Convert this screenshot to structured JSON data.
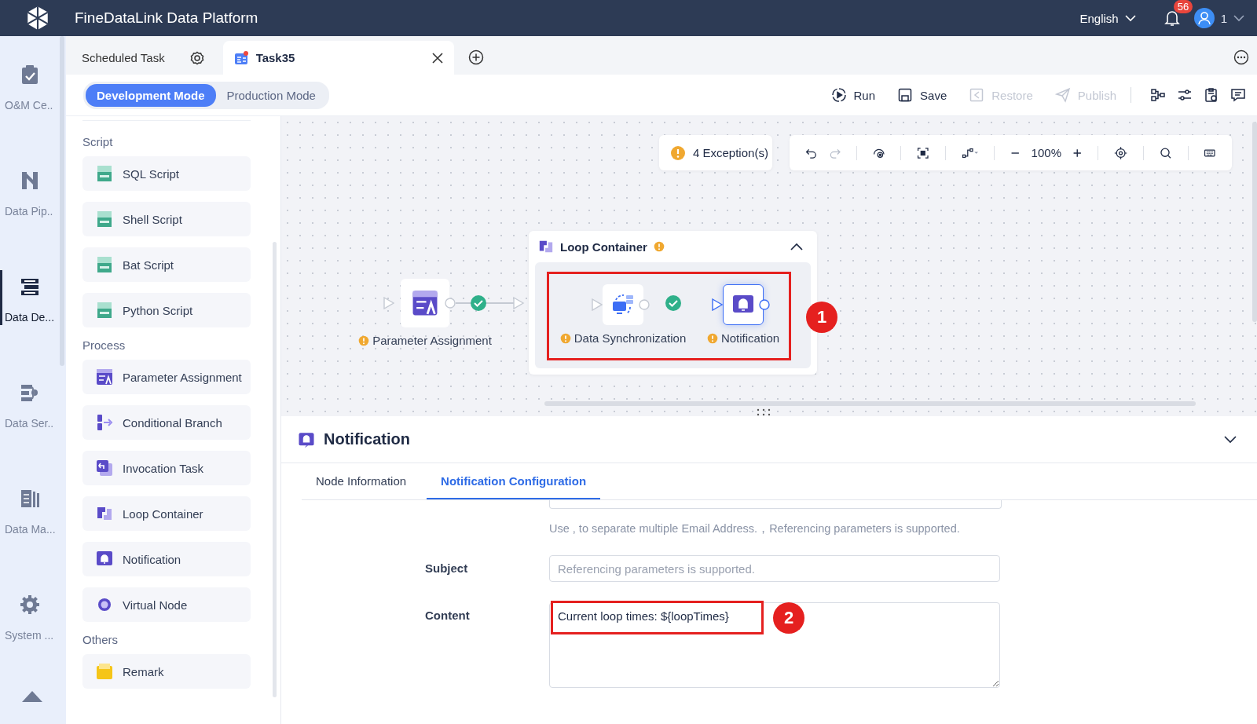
{
  "header": {
    "title": "FineDataLink Data Platform",
    "language": "English",
    "notification_count": "56",
    "user": "1"
  },
  "nav_rail": [
    {
      "label": "O&M Ce..",
      "selected": false,
      "kind": "clipboard"
    },
    {
      "label": "Data Pip..",
      "selected": false,
      "kind": "pipe"
    },
    {
      "label": "Data De...",
      "selected": true,
      "kind": "dev"
    },
    {
      "label": "Data Ser..",
      "selected": false,
      "kind": "service"
    },
    {
      "label": "Data Ma...",
      "selected": false,
      "kind": "books"
    },
    {
      "label": "System ...",
      "selected": false,
      "kind": "gear"
    }
  ],
  "tabs": [
    {
      "label": "Scheduled Task",
      "selected": false,
      "kind": "home"
    },
    {
      "label": "Task35",
      "selected": true,
      "kind": "task"
    }
  ],
  "modes": [
    {
      "label": "Development Mode",
      "selected": true
    },
    {
      "label": "Production Mode",
      "selected": false
    }
  ],
  "actions": [
    {
      "label": "Run",
      "disabled": false,
      "kind": "run"
    },
    {
      "label": "Save",
      "disabled": false,
      "kind": "save"
    },
    {
      "label": "Restore",
      "disabled": true,
      "kind": "restore"
    },
    {
      "label": "Publish",
      "disabled": true,
      "kind": "publish"
    }
  ],
  "palette": [
    {
      "title": "Script",
      "items": [
        {
          "label": "SQL Script",
          "kind": "script"
        },
        {
          "label": "Shell Script",
          "kind": "script"
        },
        {
          "label": "Bat Script",
          "kind": "script"
        },
        {
          "label": "Python Script",
          "kind": "script"
        }
      ]
    },
    {
      "title": "Process",
      "items": [
        {
          "label": "Parameter Assignment",
          "kind": "param"
        },
        {
          "label": "Conditional Branch",
          "kind": "branch"
        },
        {
          "label": "Invocation Task",
          "kind": "invoke"
        },
        {
          "label": "Loop Container",
          "kind": "loop"
        },
        {
          "label": "Notification",
          "kind": "notify"
        },
        {
          "label": "Virtual Node",
          "kind": "virtual"
        }
      ]
    },
    {
      "title": "Others",
      "items": [
        {
          "label": "Remark",
          "kind": "remark"
        }
      ]
    }
  ],
  "canvas": {
    "exceptions": "4 Exception(s)",
    "zoom": "100%",
    "node": {
      "label": "Parameter Assignment",
      "kind": "param",
      "warning": true,
      "selected": false
    },
    "container": {
      "title": "Loop Container",
      "warning": true,
      "expanded": true,
      "nodes": [
        {
          "label": "Data Synchronization",
          "kind": "sync",
          "warning": true,
          "selected": false
        },
        {
          "label": "Notification",
          "kind": "notify",
          "warning": true,
          "selected": true
        }
      ]
    },
    "callout": "1"
  },
  "details": {
    "title": "Notification",
    "expanded": true,
    "tabs": [
      {
        "label": "Node Information",
        "selected": false
      },
      {
        "label": "Notification Configuration",
        "selected": true
      }
    ],
    "help_text": "Use , to separate multiple Email Address.，Referencing parameters is supported.",
    "fields": [
      {
        "label": "Subject",
        "kind": "input",
        "placeholder": "Referencing parameters is supported."
      },
      {
        "label": "Content",
        "kind": "textarea",
        "value": "Current loop times: ${loopTimes}"
      }
    ],
    "callout": "2"
  }
}
